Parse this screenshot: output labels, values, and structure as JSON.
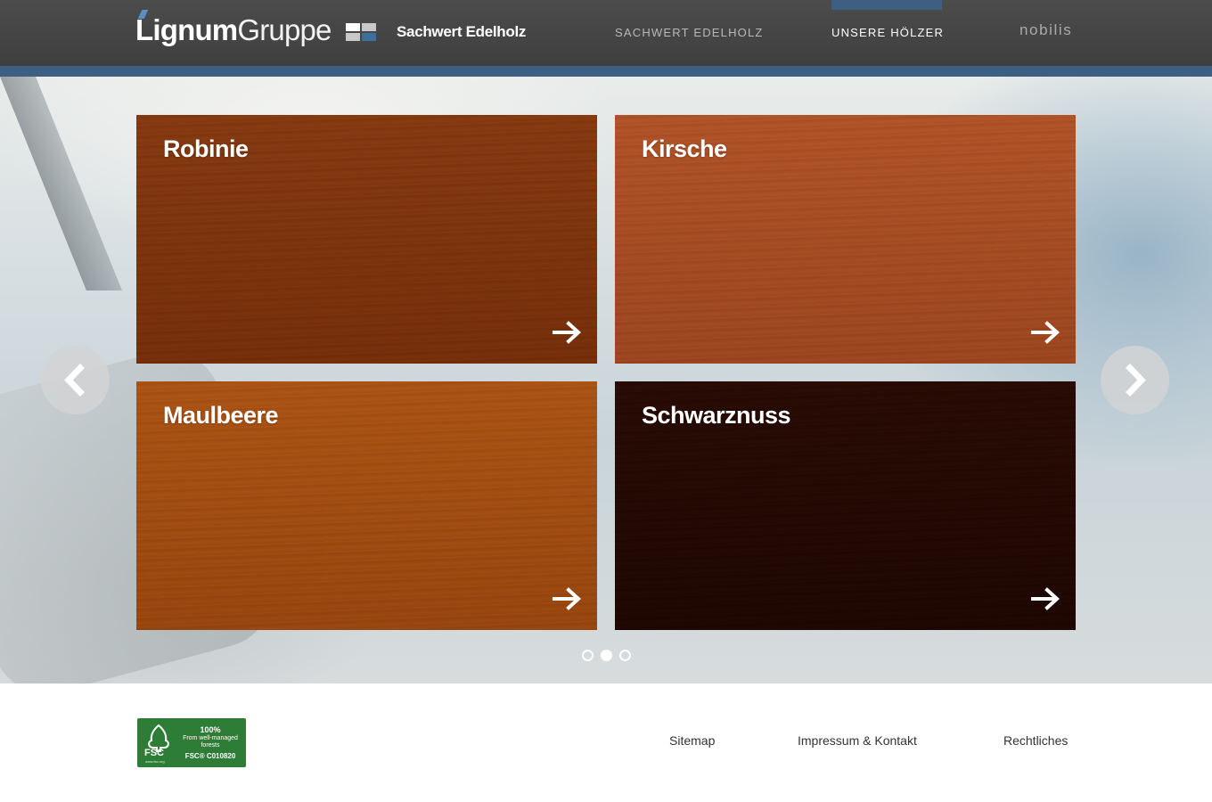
{
  "brand": {
    "logo_bold": "Lignum",
    "logo_light": "Gruppe",
    "sub_title": "Sachwert Edelholz",
    "colors": {
      "header": "#444544",
      "accent": "#3d5f82"
    }
  },
  "nav": {
    "items": [
      {
        "label": "SACHWERT EDELHOLZ",
        "active": false
      },
      {
        "label": "UNSERE HÖLZER",
        "active": true
      },
      {
        "label": "nobilis",
        "active": false
      }
    ]
  },
  "carousel": {
    "prev_icon": "chevron-left-icon",
    "next_icon": "chevron-right-icon",
    "tiles": [
      {
        "title": "Robinie",
        "color": "#b1723a",
        "icon": "arrow-right-icon"
      },
      {
        "title": "Kirsche",
        "color": "#cc8a5e",
        "icon": "arrow-right-icon"
      },
      {
        "title": "Maulbeere",
        "color": "#c98a43",
        "icon": "arrow-right-icon"
      },
      {
        "title": "Schwarznuss",
        "color": "#5e301c",
        "icon": "arrow-right-icon"
      }
    ],
    "pages": 3,
    "active_page": 2
  },
  "footer": {
    "fsc": {
      "logo_label": "FSC",
      "small_url": "www.fsc.org",
      "pct": "100%",
      "line": "From well-managed forests",
      "code": "FSC® C010820"
    },
    "links": [
      "Sitemap",
      "Impressum & Kontakt",
      "Rechtliches"
    ]
  }
}
